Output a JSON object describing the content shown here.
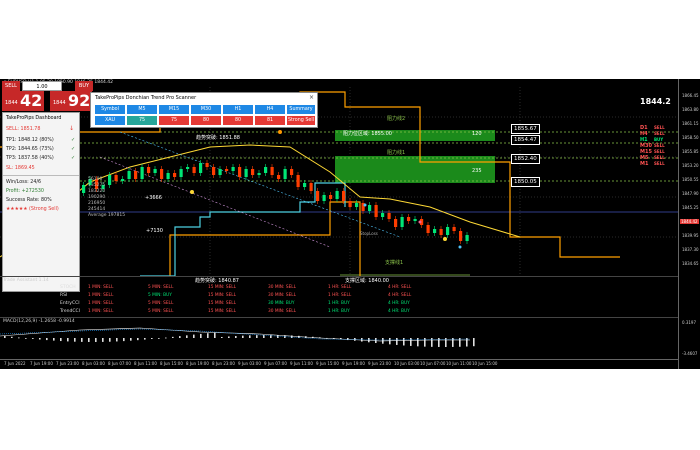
{
  "topbar": {
    "text": "▾ EURUSD,H1   1.05.29  1850.90  1846.25  1844.42"
  },
  "trade": {
    "sell_label": "SELL",
    "buy_label": "BUY",
    "lot": "1.00",
    "sell_prefix": "1844",
    "sell_price": "42",
    "buy_prefix": "1844",
    "buy_price": "92"
  },
  "scanner": {
    "title": "TakeProPips Donchian Trend Pro Scanner",
    "headers": [
      "Symbol",
      "M5",
      "M15",
      "M30",
      "H1",
      "H4",
      "Summary"
    ],
    "values": [
      "XAU",
      "75",
      "75",
      "80",
      "80",
      "81",
      "Strong Sell"
    ],
    "colors": {
      "symbol": "#1e88e5",
      "m5": "#26a69a",
      "others": "#e53935"
    }
  },
  "dashboard": {
    "title": "TakeProPips Dashboard",
    "signal": "SELL: 1851.78",
    "tp1": "TP1: 1848.12 (80%)",
    "tp2": "TP2: 1844.65 (73%)",
    "tp3": "TP3: 1837.58 (40%)",
    "sl": "SL: 1869.45",
    "winloss": "Win/Loss: 24/6",
    "profit": "Profit: +272530",
    "success": "Success Rate: 80%",
    "rating": "★★★★★ (Strong Sell)",
    "stats": [
      "56100",
      "135275",
      "183220",
      "190290",
      "216950",
      "245414",
      "Average 197815"
    ]
  },
  "chart": {
    "annotations": {
      "upper_break": "趋势突破: 1851.88",
      "upper_zone": "阻力位区域: 1855.00",
      "zone_tag_1": "阻力线2",
      "zone_tag_2": "阻力线1",
      "lower_break": "趋势突破: 1840.87",
      "lower_support": "支撑区域: 1840.00",
      "support_tag": "支撑线1",
      "plus_3666": "+3666",
      "plus_7130": "+7130",
      "stop_tag": "StopLoss"
    },
    "zone_numbers": [
      "120",
      "235"
    ],
    "line_labels": [
      "1855.67",
      "1854.47",
      "1852.40",
      "1850.05"
    ],
    "price_ticks": [
      "1866.45",
      "1863.80",
      "1861.15",
      "1858.50",
      "1855.85",
      "1853.20",
      "1850.55",
      "1847.90",
      "1845.25",
      "1842.60",
      "1839.95",
      "1837.30",
      "1834.65"
    ],
    "current_price": "1844.42"
  },
  "right_panel": {
    "price": "1844.2",
    "signals": [
      {
        "tf": "D1",
        "dir": "SELL"
      },
      {
        "tf": "H4",
        "dir": "SELL"
      },
      {
        "tf": "H1",
        "dir": "BUY"
      },
      {
        "tf": "M30",
        "dir": "SELL"
      },
      {
        "tf": "M15",
        "dir": "SELL"
      },
      {
        "tf": "M5",
        "dir": "SELL"
      },
      {
        "tf": "M1",
        "dir": "SELL"
      }
    ]
  },
  "indicator_panel": {
    "title": "Trade Assistant 1.14",
    "rows": [
      {
        "name": "STOCH",
        "cells": [
          "1 MIN: SELL",
          "5 MIN: SELL",
          "15 MIN: SELL",
          "30 MIN: SELL",
          "1 HR: SELL",
          "4 HR: SELL"
        ]
      },
      {
        "name": "RSI",
        "cells": [
          "1 MIN: SELL",
          "5 MIN: BUY",
          "15 MIN: SELL",
          "30 MIN: SELL",
          "1 HR: SELL",
          "4 HR: SELL"
        ]
      },
      {
        "name": "EntryCCI",
        "cells": [
          "1 MIN: SELL",
          "5 MIN: SELL",
          "15 MIN: SELL",
          "30 MIN: BUY",
          "1 HR: BUY",
          "4 HR: BUY"
        ]
      },
      {
        "name": "TrendCCI",
        "cells": [
          "1 MIN: SELL",
          "5 MIN: SELL",
          "15 MIN: SELL",
          "30 MIN: SELL",
          "1 HR: BUY",
          "4 HR: BUY"
        ]
      }
    ]
  },
  "macd_panel": {
    "title": "MACD(12,26,9) -1.2658 -0.9914",
    "ticks": [
      "0.3197",
      "-3.4607"
    ]
  },
  "time_axis": [
    "7 Jun 2022",
    "7 Jun 19:00",
    "7 Jun 23:00",
    "8 Jun 03:00",
    "8 Jun 07:00",
    "8 Jun 11:00",
    "8 Jun 15:00",
    "8 Jun 19:00",
    "8 Jun 23:00",
    "9 Jun 03:00",
    "9 Jun 07:00",
    "9 Jun 11:00",
    "9 Jun 15:00",
    "9 Jun 19:00",
    "9 Jun 23:00",
    "10 Jun 03:00",
    "10 Jun 07:00",
    "10 Jun 11:00",
    "10 Jun 15:00"
  ]
}
